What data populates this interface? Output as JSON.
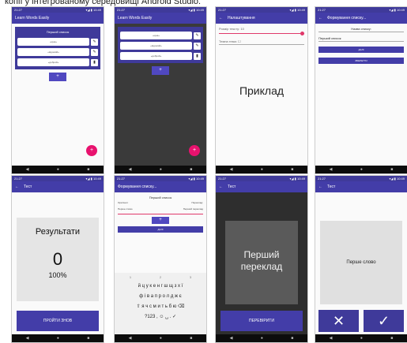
{
  "caption": "копії у інтегрованому середовищі Android Studio.",
  "status_time": "21:27",
  "status_icons": "▾◢ ▮ 10:49",
  "nav": {
    "back": "◀",
    "home": "●",
    "recent": "■"
  },
  "screen1": {
    "app_title": "Learn Words Easily",
    "card_title": "Перший список",
    "items": [
      "«ціна»",
      "«відомий»",
      "«добрий»"
    ],
    "side_icons": [
      "✎",
      "✎",
      "▮"
    ],
    "add_label": "+",
    "fab": "+"
  },
  "screen2": {
    "app_title": "Learn Words Easily",
    "items": [
      "«ціна»",
      "«відомий»",
      "«добрий»"
    ],
    "side_icons": [
      "✎",
      "✎",
      "▮"
    ],
    "add_label": "+",
    "fab": "+"
  },
  "screen3": {
    "title": "Налаштування",
    "font_size_label": "Розмір тексту: 10",
    "theme_label": "Темна тема: ☐",
    "big_text": "Приклад"
  },
  "screen4": {
    "title": "Формування списку...",
    "name_label": "Назва списку:",
    "list_label": "Перший список",
    "btn1": "ДАЛІ",
    "btn2": "ЗБЕРЕГТИ"
  },
  "screen5": {
    "title": "Тест",
    "result_title": "Результати",
    "score": "0",
    "percent": "100%",
    "btn": "ПРОЙТИ ЗНОВ"
  },
  "screen6": {
    "title": "Формування списку...",
    "list_name": "Перший список",
    "col1": "Оригінал:",
    "col2": "Переклад:",
    "orig": "Перше слово",
    "trans": "Перший переклад",
    "add_label": "+",
    "save": "ДАЛІ",
    "suggest": [
      "1",
      "2",
      "3"
    ],
    "kb_rows": [
      "й ц у к е н г ш щ з х ї",
      "ф і в а п р о л д ж є",
      "⇧ я ч с м и т ь б ю ⌫",
      "?123 , ☺ ␣ . ✓"
    ]
  },
  "screen7": {
    "title": "Тест",
    "word": "Перший переклад",
    "btn": "ПЕРЕВІРИТИ"
  },
  "screen8": {
    "title": "Тест",
    "word": "Перше слово",
    "wrong": "✕",
    "right": "✓"
  }
}
